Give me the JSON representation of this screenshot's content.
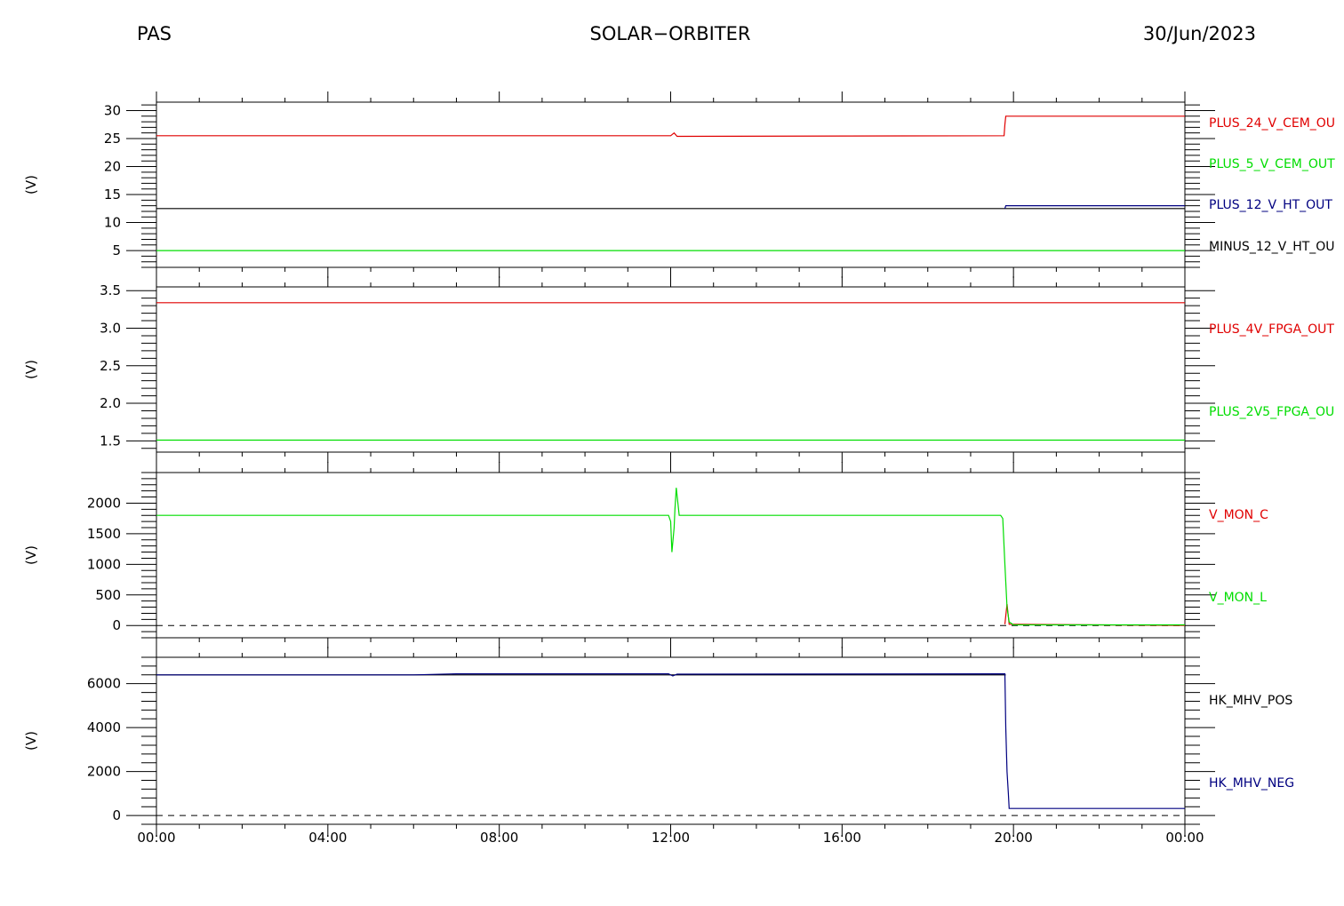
{
  "header": {
    "left": "PAS",
    "center": "SOLAR−ORBITER",
    "right": "30/Jun/2023"
  },
  "colors": {
    "red": "#e00000",
    "green": "#00dd00",
    "blue": "#000080",
    "black": "#000000"
  },
  "chart_data": [
    {
      "type": "line",
      "ylabel": "(V)",
      "ylim": [
        2,
        31.5
      ],
      "yticks": [
        30,
        25,
        20,
        15,
        10,
        5
      ],
      "ytick_labels": [
        "30",
        "25",
        "20",
        "15",
        "10",
        "5"
      ],
      "legend": [
        "PLUS_24_V_CEM_OU",
        "PLUS_5_V_CEM_OUT",
        "PLUS_12_V_HT_OUT",
        "MINUS_12_V_HT_OU"
      ],
      "series": [
        {
          "name": "MINUS_12_V_HT_OU",
          "color": "black",
          "x": [
            0,
            19.8,
            19.8,
            24
          ],
          "y": [
            12.5,
            12.5,
            12.5,
            12.5
          ]
        },
        {
          "name": "PLUS_24_V_CEM_OU",
          "color": "red",
          "x": [
            0,
            12.0,
            12.08,
            12.15,
            19.78,
            19.8,
            19.82,
            24
          ],
          "y": [
            25.5,
            25.5,
            26.0,
            25.4,
            25.5,
            27.5,
            29.0,
            29.0
          ]
        },
        {
          "name": "PLUS_5_V_CEM_OUT",
          "color": "green",
          "x": [
            0,
            24
          ],
          "y": [
            5.0,
            5.0
          ]
        },
        {
          "name": "PLUS_12_V_HT_OUT",
          "color": "blue",
          "x": [
            19.8,
            19.82,
            24
          ],
          "y": [
            12.5,
            13.0,
            13.0
          ]
        }
      ]
    },
    {
      "type": "line",
      "ylabel": "(V)",
      "ylim": [
        1.35,
        3.55
      ],
      "yticks": [
        3.5,
        3.0,
        2.5,
        2.0,
        1.5
      ],
      "ytick_labels": [
        "3.5",
        "3.0",
        "2.5",
        "2.0",
        "1.5"
      ],
      "legend": [
        "PLUS_4V_FPGA_OUT",
        "PLUS_2V5_FPGA_OU"
      ],
      "series": [
        {
          "name": "PLUS_4V_FPGA_OUT",
          "color": "red",
          "x": [
            0,
            19.8,
            24
          ],
          "y": [
            3.34,
            3.34,
            3.34
          ]
        },
        {
          "name": "PLUS_2V5_FPGA_OU",
          "color": "green",
          "x": [
            0,
            24
          ],
          "y": [
            1.51,
            1.51
          ]
        }
      ]
    },
    {
      "type": "line",
      "ylabel": "(V)",
      "ylim": [
        -200,
        2500
      ],
      "yticks": [
        2000,
        1500,
        1000,
        500,
        0
      ],
      "ytick_labels": [
        "2000",
        "1500",
        "1000",
        "500",
        "0"
      ],
      "zero_line": true,
      "legend": [
        "V_MON_C",
        "V_MON_L"
      ],
      "series": [
        {
          "name": "V_MON_C",
          "color": "red",
          "x": [
            19.8,
            19.85,
            19.9,
            24
          ],
          "y": [
            20,
            350,
            20,
            0
          ]
        },
        {
          "name": "V_MON_L",
          "color": "green",
          "x": [
            0,
            11.95,
            12.0,
            12.03,
            12.08,
            12.1,
            12.13,
            12.2,
            19.7,
            19.75,
            19.8,
            19.85,
            19.9,
            20.0,
            24
          ],
          "y": [
            1800,
            1800,
            1700,
            1200,
            1600,
            1900,
            2250,
            1800,
            1800,
            1750,
            1000,
            300,
            60,
            10,
            10
          ]
        }
      ]
    },
    {
      "type": "line",
      "ylabel": "(V)",
      "ylim": [
        -400,
        7200
      ],
      "yticks": [
        6000,
        4000,
        2000,
        0
      ],
      "ytick_labels": [
        "6000",
        "4000",
        "2000",
        "0"
      ],
      "zero_line": true,
      "x_tick_labels": [
        "00:00",
        "04:00",
        "08:00",
        "12:00",
        "16:00",
        "20:00",
        "00:00"
      ],
      "legend": [
        "HK_MHV_POS",
        "HK_MHV_NEG"
      ],
      "series": [
        {
          "name": "HK_MHV_POS",
          "color": "black",
          "x": [
            0,
            19.82
          ],
          "y": [
            6400,
            6400
          ]
        },
        {
          "name": "HK_MHV_NEG",
          "color": "blue",
          "x": [
            0,
            6.0,
            7.0,
            11.95,
            12.05,
            12.15,
            19.8,
            19.82,
            19.85,
            19.88,
            19.9,
            24
          ],
          "y": [
            6400,
            6400,
            6450,
            6450,
            6350,
            6430,
            6450,
            4000,
            2000,
            1000,
            320,
            320
          ]
        }
      ]
    }
  ]
}
